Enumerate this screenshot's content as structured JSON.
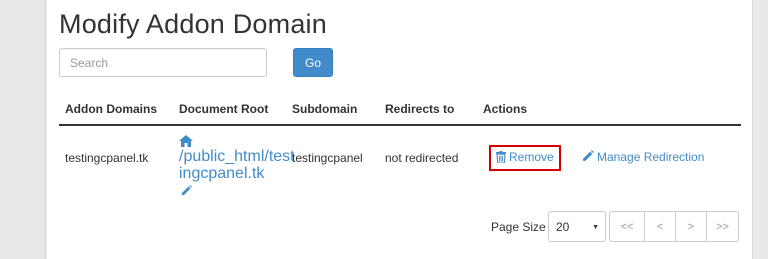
{
  "page": {
    "title": "Modify Addon Domain"
  },
  "search": {
    "placeholder": "Search",
    "go_label": "Go"
  },
  "table": {
    "headers": [
      "Addon Domains",
      "Document Root",
      "Subdomain",
      "Redirects to",
      "Actions"
    ],
    "rows": [
      {
        "domain": "testingcpanel.tk",
        "docroot_line1": "/public_html/test",
        "docroot_line2": "ingcpanel.tk",
        "subdomain": "testingcpanel",
        "redirects": "not redirected",
        "remove_label": "Remove",
        "manage_label": "Manage Redirection"
      }
    ]
  },
  "pagination": {
    "page_size_label": "Page Size",
    "page_size_value": "20",
    "buttons": [
      "<<",
      "<",
      ">",
      ">>"
    ]
  },
  "colors": {
    "link": "#428bca",
    "primary_button": "#428bca",
    "highlight_border": "#d40000"
  }
}
